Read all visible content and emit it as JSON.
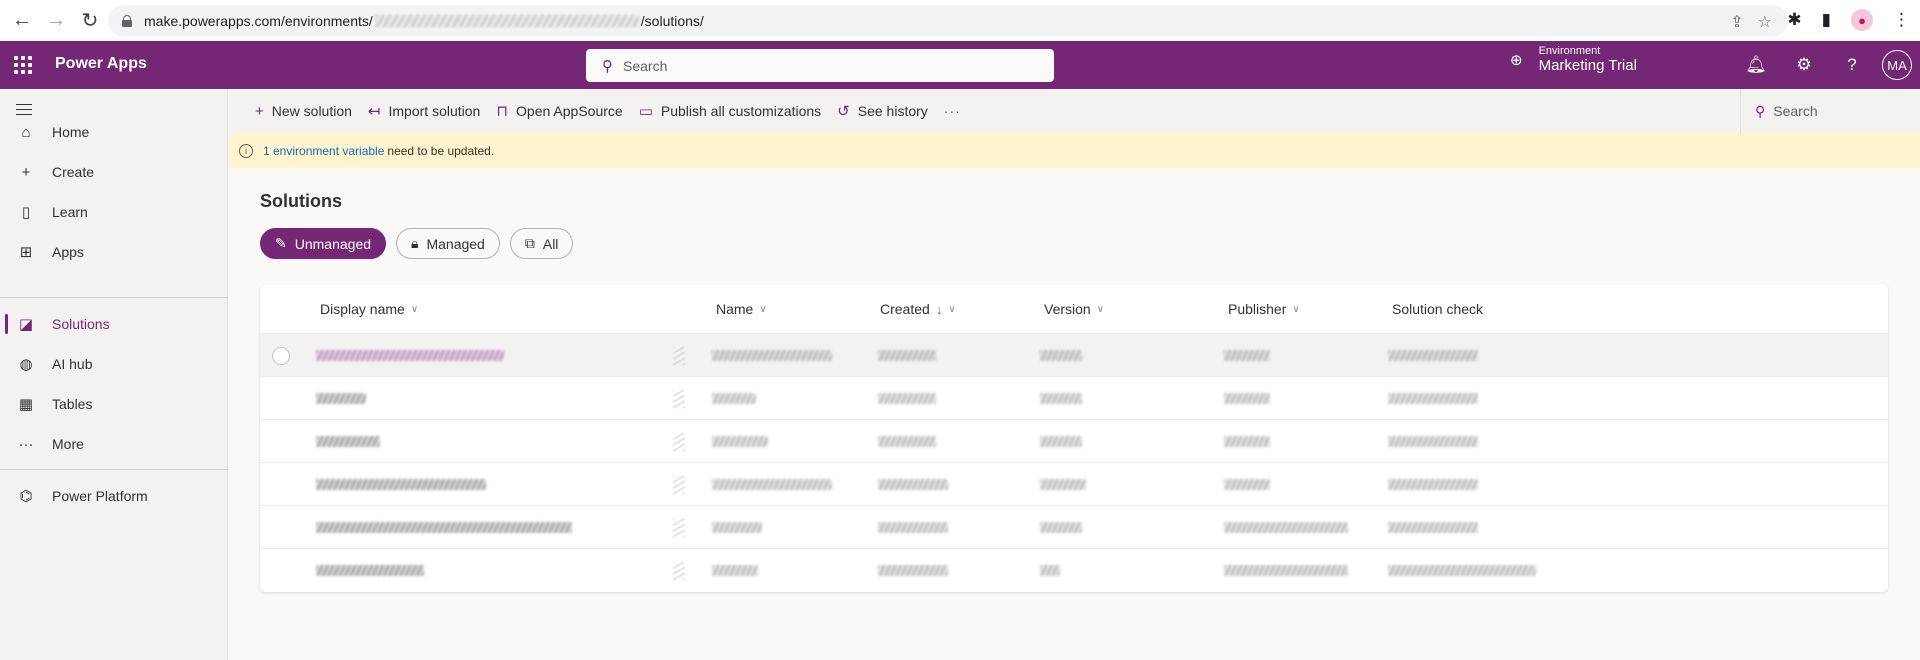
{
  "browser": {
    "url_prefix": "make.powerapps.com/environments/",
    "url_suffix": "/solutions/",
    "back_icon": "←",
    "forward_icon": "→",
    "reload_icon": "↻",
    "share_icon": "⇪",
    "star_icon": "☆",
    "extensions_icon": "✱",
    "sidepanel_icon": "▮",
    "profile_icon": "●",
    "menu_icon": "⋮"
  },
  "appbar": {
    "title": "Power Apps",
    "search_placeholder": "Search",
    "search_icon": "⚲",
    "environment_label": "Environment",
    "environment_name": "Marketing Trial",
    "environment_icon": "⊕",
    "bell_icon": "🔔︎",
    "settings_icon": "⚙",
    "help_icon": "?",
    "user_initials": "MA"
  },
  "sidebar": {
    "items": [
      {
        "label": "Home",
        "icon": "⌂"
      },
      {
        "label": "Create",
        "icon": "+"
      },
      {
        "label": "Learn",
        "icon": "▯"
      },
      {
        "label": "Apps",
        "icon": "⊞"
      },
      {
        "label": "Solutions",
        "icon": "◪",
        "active": true
      },
      {
        "label": "AI hub",
        "icon": "◍"
      },
      {
        "label": "Tables",
        "icon": "▦"
      },
      {
        "label": "More",
        "icon": "···"
      },
      {
        "label": "Power Platform",
        "icon": "⌬"
      }
    ]
  },
  "commandbar": {
    "items": [
      {
        "label": "New solution",
        "icon": "+"
      },
      {
        "label": "Import solution",
        "icon": "↤"
      },
      {
        "label": "Open AppSource",
        "icon": "⊓"
      },
      {
        "label": "Publish all customizations",
        "icon": "▭"
      },
      {
        "label": "See history",
        "icon": "↺"
      }
    ],
    "more": "···",
    "search_placeholder": "Search",
    "search_icon": "⚲"
  },
  "banner": {
    "info_icon": "i",
    "link_text": "1 environment variable",
    "message": "need to be updated."
  },
  "page": {
    "title": "Solutions",
    "filters": [
      {
        "label": "Unmanaged",
        "icon": "✎",
        "active": true
      },
      {
        "label": "Managed",
        "icon": "🔒︎",
        "active": false
      },
      {
        "label": "All",
        "icon": "⧉",
        "active": false
      }
    ]
  },
  "table": {
    "columns": [
      {
        "label": "Display name",
        "chevron": "∨"
      },
      {
        "label": "Name",
        "chevron": "∨"
      },
      {
        "label": "Created",
        "sort": "↓",
        "chevron": "∨"
      },
      {
        "label": "Version",
        "chevron": "∨"
      },
      {
        "label": "Publisher",
        "chevron": "∨"
      },
      {
        "label": "Solution check"
      }
    ],
    "rows_note": "cell values redacted (blurred)",
    "row_count": 6,
    "selected_row": 0
  }
}
